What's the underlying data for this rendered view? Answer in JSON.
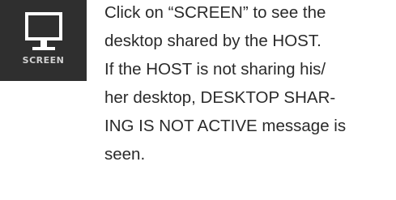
{
  "screen_button": {
    "label": "SCREEN",
    "icon": "monitor-icon",
    "colors": {
      "background": "#2f2f2f",
      "icon": "#ffffff",
      "label": "#d2d2d2"
    }
  },
  "instruction": {
    "lines": [
      "Click on “SCREEN” to see the",
      "desktop shared by the HOST.",
      "If the HOST is not sharing his/",
      "her desktop, DESKTOP SHAR-",
      "ING IS NOT ACTIVE message is",
      "seen."
    ],
    "text_color": "#2a2a2a"
  }
}
